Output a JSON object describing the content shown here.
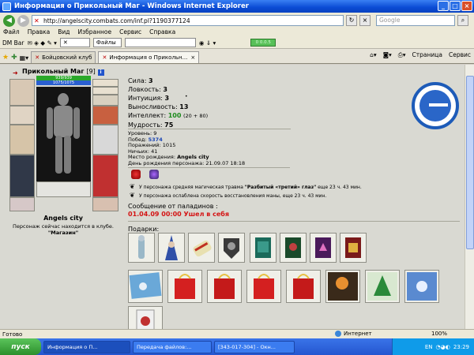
{
  "window": {
    "title": "Информация о Прикольный Маг - Windows Internet Explorer"
  },
  "address": {
    "url": "http://angelscity.combats.com/inf.pl?1190377124",
    "search_placeholder": "Google"
  },
  "menu": [
    "Файл",
    "Правка",
    "Вид",
    "Избранное",
    "Сервис",
    "Справка"
  ],
  "toolbar2": {
    "dm_bar": "DM Bar",
    "files": "Файлы",
    "green_box": "0 0.0.5"
  },
  "tabs": [
    {
      "label": "Бойцовский клуб",
      "active": false
    },
    {
      "label": "Информация о Прикольн...",
      "active": true
    }
  ],
  "tab_commands": {
    "page": "Страница",
    "service": "Сервис"
  },
  "character": {
    "name": "Прикольный Маг",
    "level": "[9]",
    "hp": "939/939",
    "mp": "1075/1075",
    "city": "Angels city",
    "location_text": "Персонаж сейчас находится в клубе.",
    "location_room": "\"Магазин\""
  },
  "stats": {
    "str_label": "Сила:",
    "str": "3",
    "agi_label": "Ловкость:",
    "agi": "3",
    "int_label": "Интуиция:",
    "int": "3",
    "end_label": "Выносливость:",
    "end": "13",
    "intel_label": "Интеллект:",
    "intel": "100",
    "intel_bonus": "(20 + 80)",
    "wis_label": "Мудрость:",
    "wis": "75"
  },
  "record": {
    "level_label": "Уровень:",
    "level": "9",
    "wins_label": "Побед:",
    "wins": "5374",
    "losses_label": "Поражений:",
    "losses": "1015",
    "draws_label": "Ничьих:",
    "draws": "41",
    "birthplace_label": "Место рождения:",
    "birthplace": "Angels city",
    "birthday_label": "День рождения персонажа:",
    "birthday": "21.09.07 18:18"
  },
  "effects": [
    {
      "prefix": "У персонажа средняя магическая травма ",
      "bold": "\"Разбитый «третий» глаз\"",
      "suffix": " еще 23 ч. 43 мин."
    },
    {
      "prefix": "У персонажа ослаблена скорость восстановления маны, еще 23 ч. 43 мин.",
      "bold": "",
      "suffix": ""
    }
  ],
  "message": {
    "label": "Сообщение от паладинов :",
    "text": "01.04.09 00:00 Ушел в себя"
  },
  "gifts_label": "Подарки:",
  "status": {
    "ready": "Готово",
    "zone": "Интернет",
    "zoom": "100%"
  },
  "taskbar": {
    "start": "пуск",
    "tasks": [
      "Информация о П...",
      "Передача файлов:...",
      "[343-017-304] - Окн..."
    ],
    "lang": "EN",
    "clock": "23:29"
  }
}
